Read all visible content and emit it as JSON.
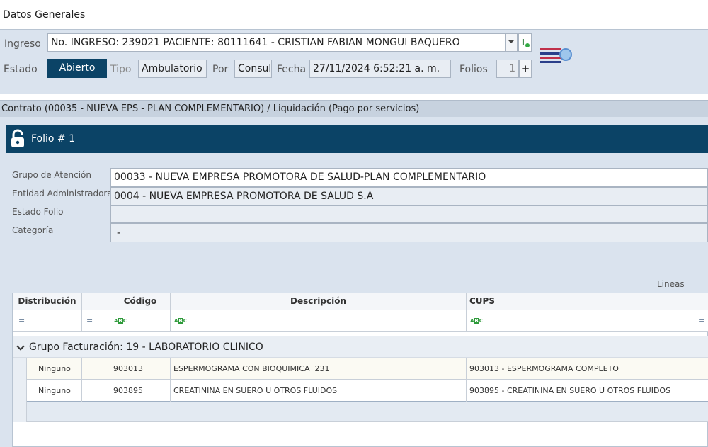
{
  "section_title": "Datos Generales",
  "ingreso": {
    "label": "Ingreso",
    "value": "No. INGRESO: 239021 PACIENTE: 80111641 - CRISTIAN FABIAN MONGUI BAQUERO"
  },
  "estado": {
    "label": "Estado",
    "value": "Abierto"
  },
  "tipo": {
    "label": "Tipo",
    "value": "Ambulatorio"
  },
  "por": {
    "label": "Por",
    "value": "Consul"
  },
  "fecha": {
    "label": "Fecha",
    "value": "27/11/2024 6:52:21 a. m."
  },
  "folios": {
    "label": "Folios",
    "value": "1",
    "add": "+"
  },
  "contrato_bar": "Contrato (00035 - NUEVA EPS - PLAN COMPLEMENTARIO) / Liquidación (Pago por servicios)",
  "folio_title": "Folio # 1",
  "folio_fields": {
    "grupo_label": "Grupo de Atención",
    "grupo_value": "00033 - NUEVA EMPRESA PROMOTORA DE SALUD-PLAN COMPLEMENTARIO",
    "entidad_label": "Entidad Administradora",
    "entidad_value": "0004 - NUEVA EMPRESA PROMOTORA DE SALUD S.A",
    "estado_label": "Estado Folio",
    "estado_value": "",
    "categoria_label": "Categoría",
    "categoria_value": "-"
  },
  "lineas_label": "Lineas",
  "grid": {
    "headers": [
      "Distribución",
      "",
      "Código",
      "Descripción",
      "CUPS"
    ],
    "group_label": "Grupo Facturación: 19 - LABORATORIO CLINICO",
    "rows": [
      {
        "distribucion": "Ninguno",
        "codigo": "903013",
        "descripcion": "ESPERMOGRAMA CON BIOQUIMICA  231",
        "cups": "903013 - ESPERMOGRAMA COMPLETO"
      },
      {
        "distribucion": "Ninguno",
        "codigo": "903895",
        "descripcion": "CREATININA EN SUERO U OTROS FLUIDOS",
        "cups": "903895 - CREATININA EN SUERO U OTROS FLUIDOS"
      }
    ]
  },
  "colors": {
    "header_bg": "#dae3ee",
    "folio_bar": "#0b4366",
    "estado_badge": "#0b4366"
  }
}
